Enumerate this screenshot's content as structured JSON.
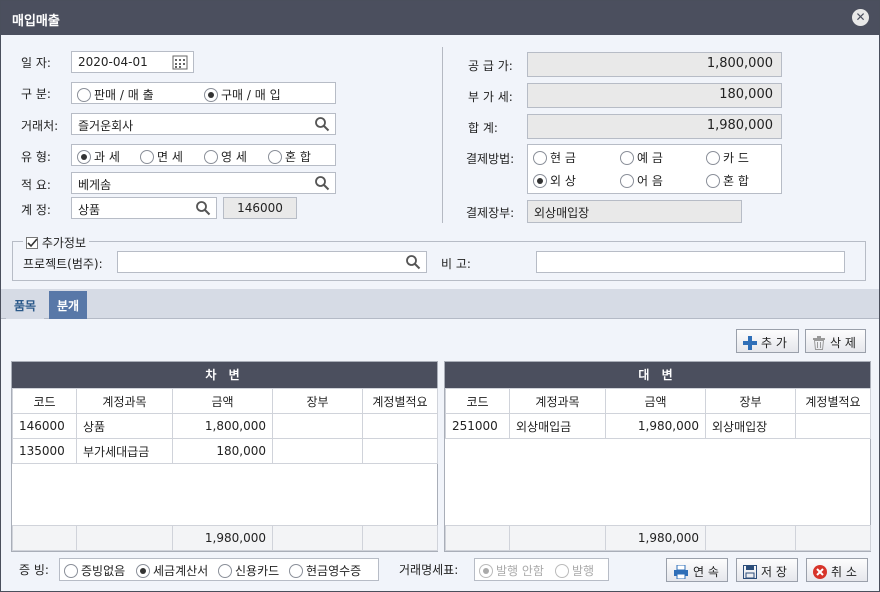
{
  "window": {
    "title": "매입매출"
  },
  "form": {
    "date": {
      "label": "일    자:",
      "value": "2020-04-01"
    },
    "type": {
      "label": "구    분:",
      "options": [
        "판매 / 매 출",
        "구매 / 매 입"
      ],
      "selected": 1
    },
    "partner": {
      "label": "거래처:",
      "value": "즐거운회사"
    },
    "kind": {
      "label": "유    형:",
      "options": [
        "과 세",
        "면 세",
        "영 세",
        "혼 합"
      ],
      "selected": 0
    },
    "memo": {
      "label": "적    요:",
      "value": "베게솜"
    },
    "account": {
      "label": "계    정:",
      "value": "상품",
      "code": "146000"
    },
    "supply": {
      "label": "공 급 가:",
      "value": "1,800,000"
    },
    "vat": {
      "label": "부 가 세:",
      "value": "180,000"
    },
    "total": {
      "label": "합    계:",
      "value": "1,980,000"
    },
    "payment": {
      "label": "결제방법:",
      "options": [
        "현 금",
        "예 금",
        "카 드",
        "외 상",
        "어 음",
        "혼 합"
      ],
      "selected": 3
    },
    "ledger": {
      "label": "결제장부:",
      "value": "외상매입장"
    }
  },
  "extra": {
    "legend": "추가정보",
    "project_label": "프로젝트(범주):",
    "project_value": "",
    "note_label": "비    고:",
    "note_value": ""
  },
  "tabs": [
    {
      "label": "품목",
      "active": false
    },
    {
      "label": "분개",
      "active": true
    }
  ],
  "toolbar": {
    "add": "추 가",
    "delete": "삭 제"
  },
  "debit": {
    "title": "차 변",
    "columns": [
      "코드",
      "계정과목",
      "금액",
      "장부",
      "계정별적요"
    ],
    "rows": [
      [
        "146000",
        "상품",
        "1,800,000",
        "",
        ""
      ],
      [
        "135000",
        "부가세대급금",
        "180,000",
        "",
        ""
      ]
    ],
    "total": "1,980,000"
  },
  "credit": {
    "title": "대 변",
    "columns": [
      "코드",
      "계정과목",
      "금액",
      "장부",
      "계정별적요"
    ],
    "rows": [
      [
        "251000",
        "외상매입금",
        "1,980,000",
        "외상매입장",
        ""
      ]
    ],
    "total": "1,980,000"
  },
  "evidence": {
    "label": "증  빙:",
    "options": [
      "증빙없음",
      "세금계산서",
      "신용카드",
      "현금영수증"
    ],
    "selected": 1
  },
  "statement": {
    "label": "거래명세표:",
    "options": [
      "발행 안함",
      "발행"
    ],
    "selected": 0
  },
  "buttons": {
    "continue": "연 속",
    "save": "저 장",
    "cancel": "취 소"
  }
}
